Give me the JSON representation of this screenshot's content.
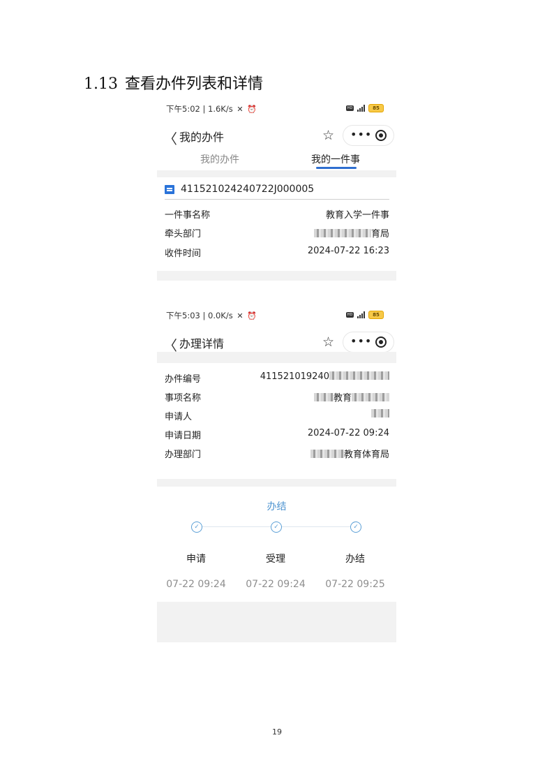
{
  "document": {
    "section_number": "1.13",
    "section_title": "查看办件列表和详情",
    "page_number": "19"
  },
  "screenshot_1": {
    "status_bar": {
      "time": "下午5:02",
      "speed": "1.6K/s",
      "battery": "85",
      "network": "5G"
    },
    "nav": {
      "title": "我的办件"
    },
    "tabs": [
      {
        "label": "我的办件",
        "active": false
      },
      {
        "label": "我的一件事",
        "active": true
      }
    ],
    "card": {
      "case_number": "411521024240722J000005",
      "rows": [
        {
          "label": "一件事名称",
          "value": "教育入学一件事"
        },
        {
          "label": "牵头部门",
          "value": "育局"
        },
        {
          "label": "收件时间",
          "value": "2024-07-22 16:23"
        }
      ]
    }
  },
  "screenshot_2": {
    "status_bar": {
      "time": "下午5:03",
      "speed": "0.0K/s",
      "battery": "85",
      "network": "5G"
    },
    "nav": {
      "title": "办理详情"
    },
    "rows": [
      {
        "label": "办件编号",
        "value": "411521019240"
      },
      {
        "label": "事项名称",
        "value": "教育"
      },
      {
        "label": "申请人",
        "value": ""
      },
      {
        "label": "申请日期",
        "value": "2024-07-22 09:24"
      },
      {
        "label": "办理部门",
        "value": "教育体育局"
      }
    ],
    "progress": {
      "status": "办结",
      "steps": [
        {
          "label": "申请",
          "time": "07-22 09:24",
          "done": true
        },
        {
          "label": "受理",
          "time": "07-22 09:24",
          "done": true
        },
        {
          "label": "办结",
          "time": "07-22 09:25",
          "done": true
        }
      ]
    }
  },
  "icons": {
    "back": "chevron-left-icon",
    "favorite": "star-outline-icon",
    "more": "more-dots-icon",
    "target": "record-target-icon",
    "case": "flag-message-icon",
    "check": "check-circle-icon"
  },
  "colors": {
    "accent": "#2f6fd0",
    "progress": "#4c93d0",
    "muted": "#8e8e8e",
    "band": "#f2f2f2"
  }
}
